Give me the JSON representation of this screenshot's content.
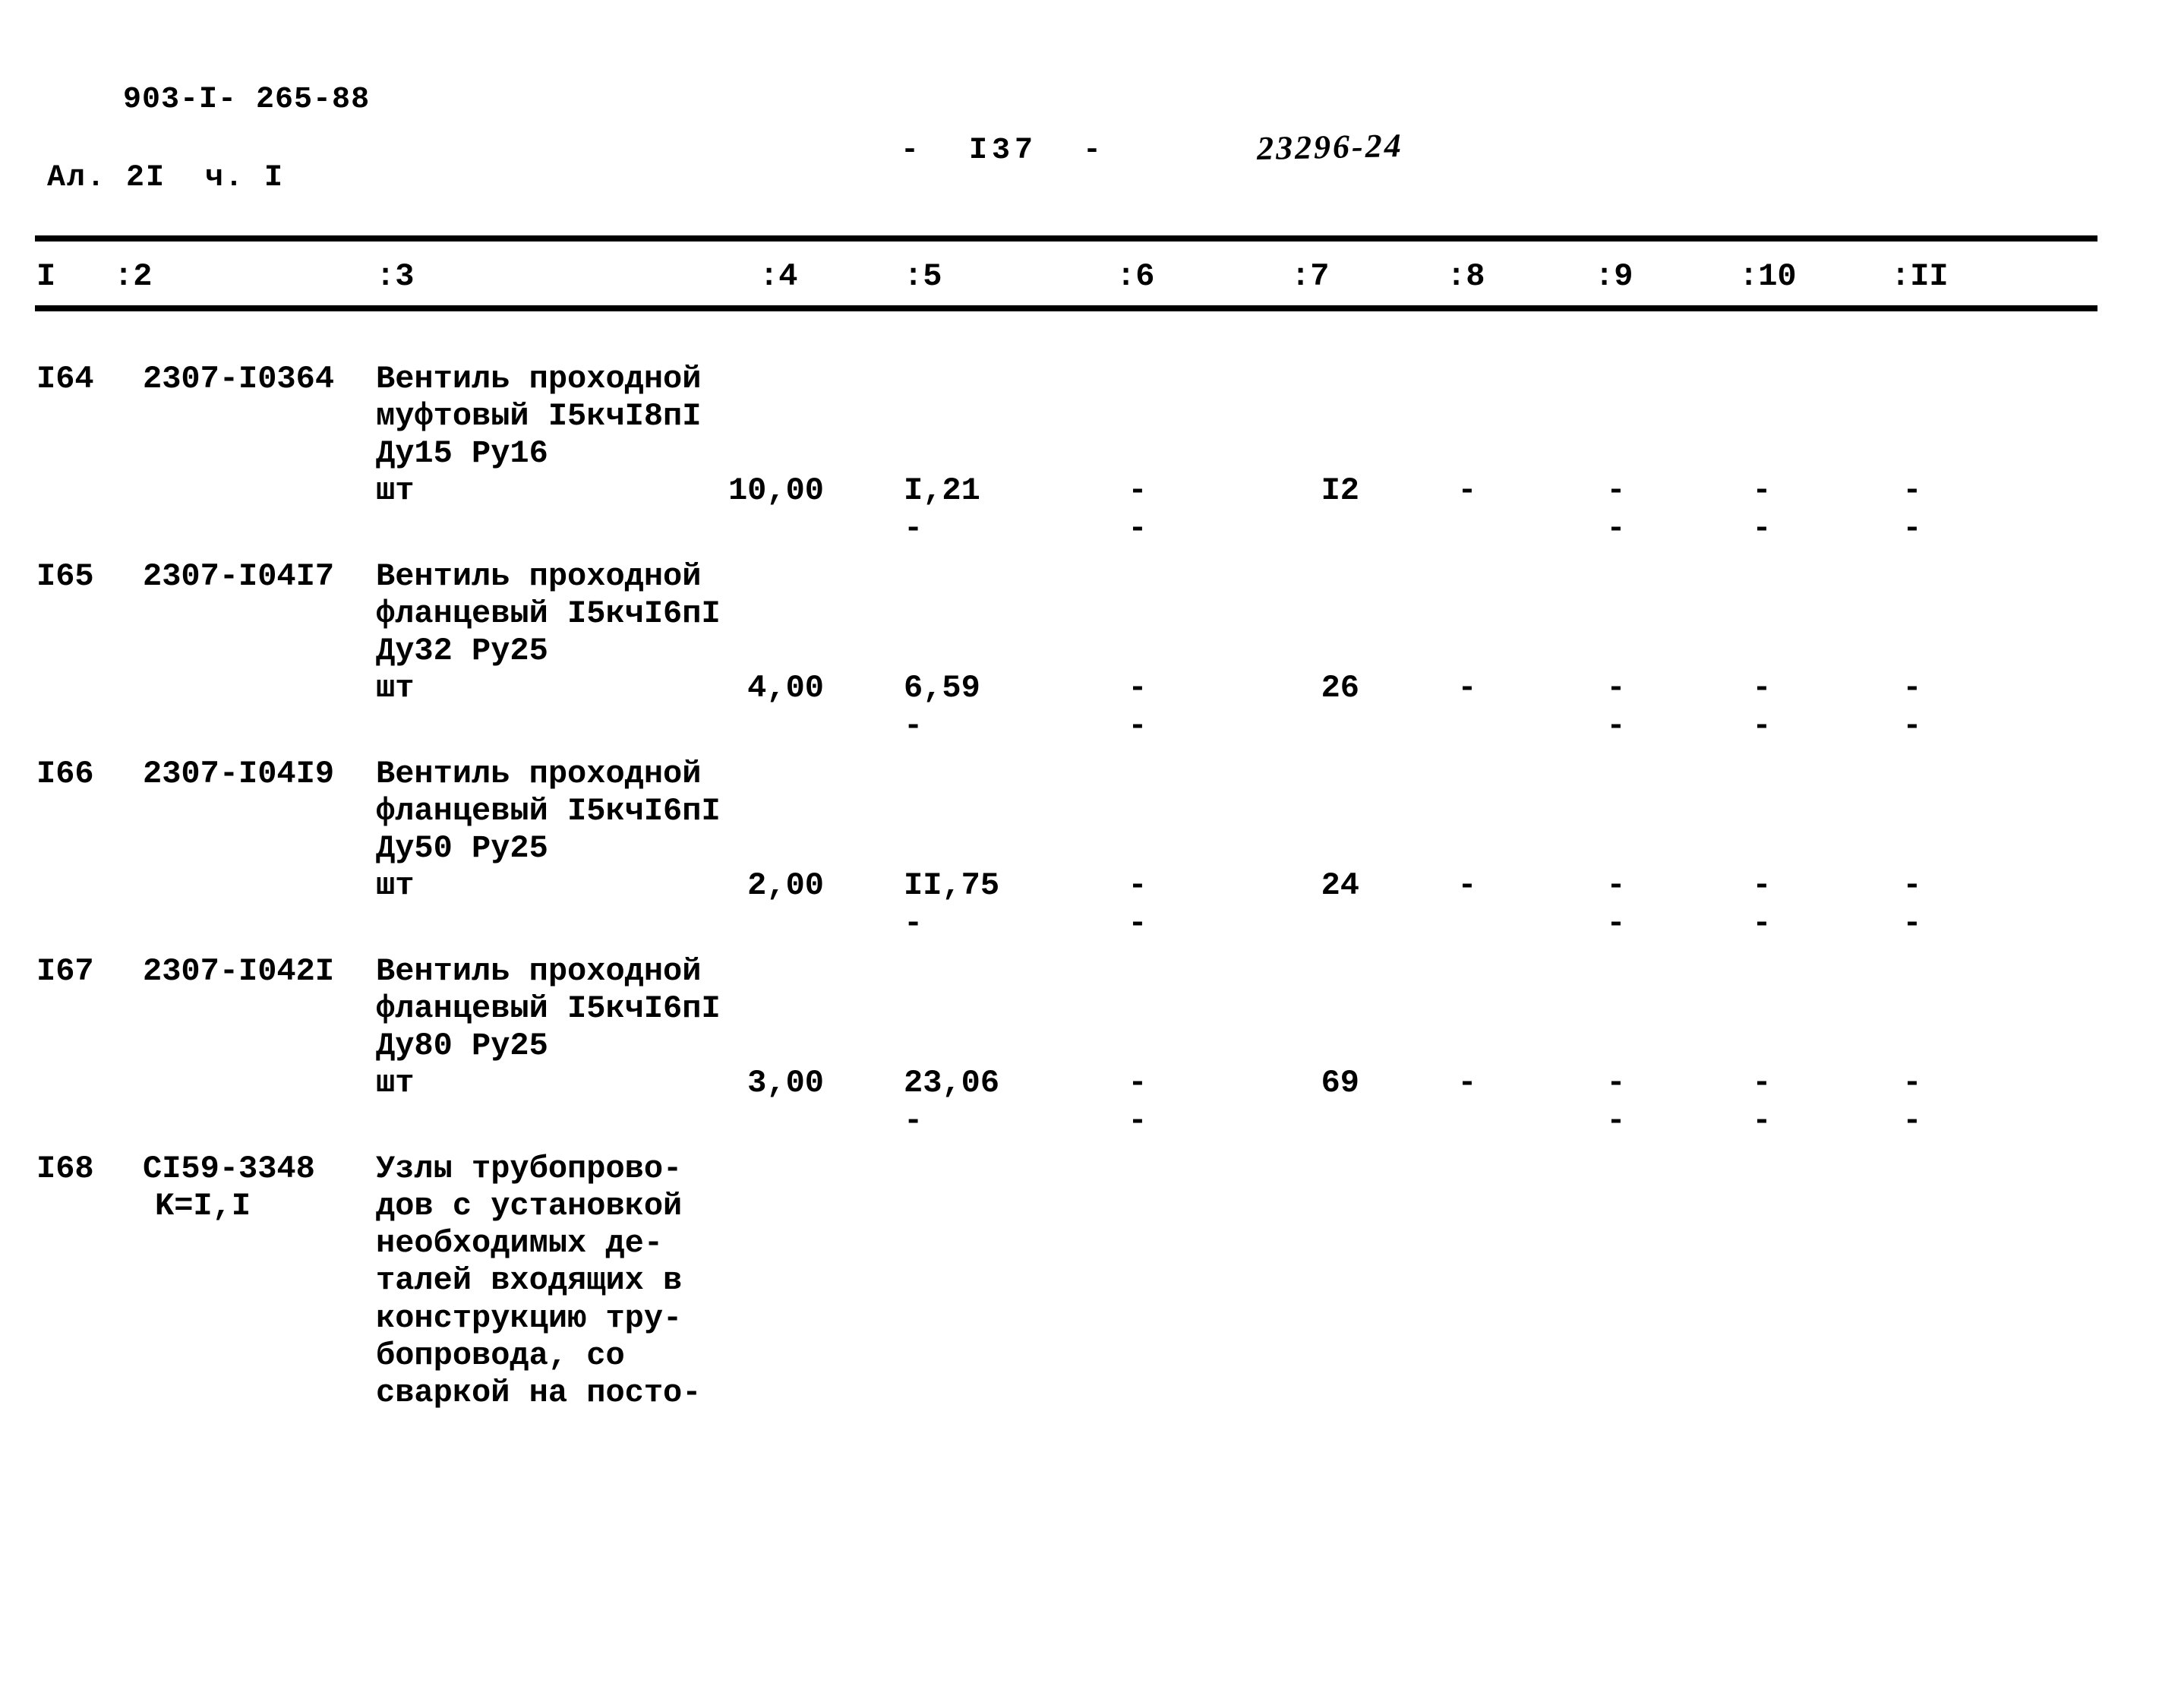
{
  "header": {
    "doc_code_line1": "903-I- 265-88",
    "doc_code_line2": "Ал. 2I  ч. I",
    "page_number": "-  I37  -",
    "stamp": "23296-24"
  },
  "table": {
    "column_headers": [
      "I",
      ":2",
      ":3",
      ":4",
      ":5",
      ":6",
      ":7",
      ":8",
      ":9",
      ":10",
      ":II"
    ],
    "rows": [
      {
        "num": "I64",
        "code": "2307-I0364",
        "description_lines": [
          "Вентиль проходной",
          "муфтовый I5кчI8пI",
          "Ду15 Ру16",
          "шт"
        ],
        "c4": "10,00",
        "c5": "I,21",
        "c5_second": "-",
        "c6": "-",
        "c6_second": "-",
        "c7": "I2",
        "c8": "-",
        "c8_second": "",
        "c9": "-",
        "c9_second": "-",
        "c10": "-",
        "c10_second": "-",
        "c11": "-",
        "c11_second": "-"
      },
      {
        "num": "I65",
        "code": "2307-I04I7",
        "description_lines": [
          "Вентиль проходной",
          "фланцевый I5кчI6пI",
          "Ду32 Ру25",
          "шт"
        ],
        "c4": "4,00",
        "c5": "6,59",
        "c5_second": "-",
        "c6": "-",
        "c6_second": "-",
        "c7": "26",
        "c8": "-",
        "c8_second": "",
        "c9": "-",
        "c9_second": "-",
        "c10": "-",
        "c10_second": "-",
        "c11": "-",
        "c11_second": "-"
      },
      {
        "num": "I66",
        "code": "2307-I04I9",
        "description_lines": [
          "Вентиль проходной",
          "фланцевый I5кчI6пI",
          "Ду50 Ру25",
          "шт"
        ],
        "c4": "2,00",
        "c5": "II,75",
        "c5_second": "-",
        "c6": "-",
        "c6_second": "-",
        "c7": "24",
        "c8": "-",
        "c8_second": "",
        "c9": "-",
        "c9_second": "-",
        "c10": "-",
        "c10_second": "-",
        "c11": "-",
        "c11_second": "-"
      },
      {
        "num": "I67",
        "code": "2307-I042I",
        "description_lines": [
          "Вентиль проходной",
          "фланцевый I5кчI6пI",
          "Ду80 Ру25",
          "шт"
        ],
        "c4": "3,00",
        "c5": "23,06",
        "c5_second": "-",
        "c6": "-",
        "c6_second": "-",
        "c7": "69",
        "c8": "-",
        "c8_second": "",
        "c9": "-",
        "c9_second": "-",
        "c10": "-",
        "c10_second": "-",
        "c11": "-",
        "c11_second": "-"
      },
      {
        "num": "I68",
        "code": "CI59-3348",
        "code_sub": "K=I,I",
        "description_lines": [
          "Узлы трубопрово-",
          "дов с установкой",
          "необходимых де-",
          "талей входящих в",
          "конструкцию тру-",
          "бопровода, со",
          "сваркой на посто-"
        ],
        "c4": "",
        "c5": "",
        "c5_second": "",
        "c6": "",
        "c6_second": "",
        "c7": "",
        "c8": "",
        "c8_second": "",
        "c9": "",
        "c9_second": "",
        "c10": "",
        "c10_second": "",
        "c11": "",
        "c11_second": ""
      }
    ]
  }
}
